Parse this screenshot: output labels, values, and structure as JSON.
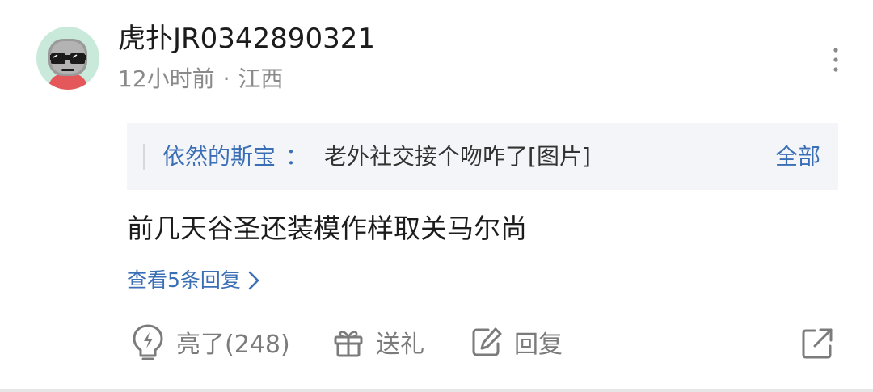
{
  "post": {
    "username": "虎扑JR0342890321",
    "time": "12小时前",
    "separator": "·",
    "location": "江西"
  },
  "quote": {
    "author": "依然的斯宝",
    "colon": "：",
    "content": "老外社交接个吻咋了[图片]",
    "all_label": "全部"
  },
  "comment": {
    "text": "前几天谷圣还装模作样取关马尔尚"
  },
  "replies": {
    "label": "查看5条回复"
  },
  "actions": {
    "like_label": "亮了(248)",
    "gift_label": "送礼",
    "reply_label": "回复"
  },
  "colors": {
    "link_blue": "#3a6fb6",
    "quote_bg": "#f4f5f9",
    "avatar_bg": "#c9eadb"
  },
  "icons": [
    "avatar",
    "more-vertical-icon",
    "chevron-right-icon",
    "lightbulb-icon",
    "gift-icon",
    "edit-reply-icon",
    "share-icon"
  ]
}
